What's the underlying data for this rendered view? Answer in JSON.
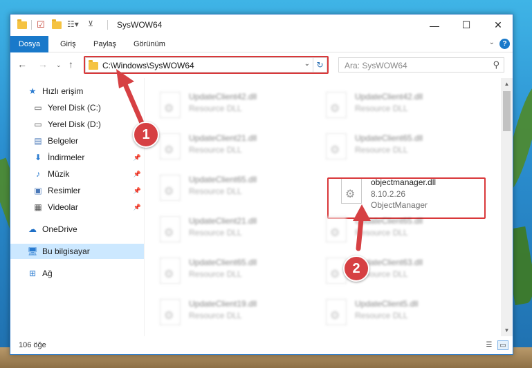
{
  "window": {
    "title": "SysWOW64",
    "minimize": "—",
    "maximize": "☐",
    "close": "✕"
  },
  "ribbon": {
    "tabs": [
      "Dosya",
      "Giriş",
      "Paylaş",
      "Görünüm"
    ],
    "help": "?"
  },
  "nav": {
    "address": "C:\\Windows\\SysWOW64",
    "search_placeholder": "Ara: SysWOW64"
  },
  "sidebar": {
    "items": [
      {
        "label": "Hızlı erişim",
        "icon": "star-icon"
      },
      {
        "label": "Yerel Disk (C:)",
        "icon": "drive-icon"
      },
      {
        "label": "Yerel Disk (D:)",
        "icon": "drive-icon"
      },
      {
        "label": "Belgeler",
        "icon": "documents-icon"
      },
      {
        "label": "İndirmeler",
        "icon": "download-icon"
      },
      {
        "label": "Müzik",
        "icon": "music-icon"
      },
      {
        "label": "Resimler",
        "icon": "pictures-icon"
      },
      {
        "label": "Videolar",
        "icon": "videos-icon"
      },
      {
        "label": "OneDrive",
        "icon": "cloud-icon"
      },
      {
        "label": "Bu bilgisayar",
        "icon": "computer-icon"
      },
      {
        "label": "Ağ",
        "icon": "network-icon"
      }
    ]
  },
  "files": [
    {
      "name": "UpdateClient42.dll",
      "type": "Resource DLL"
    },
    {
      "name": "UpdateClient42.dll",
      "type": "Resource DLL"
    },
    {
      "name": "UpdateClient21.dll",
      "type": "Resource DLL"
    },
    {
      "name": "UpdateClient65.dll",
      "type": "Resource DLL"
    },
    {
      "name": "UpdateClient65.dll",
      "type": "Resource DLL"
    },
    {
      "name": "objectmanager.dll",
      "version": "8.10.2.26",
      "type": "ObjectManager"
    },
    {
      "name": "UpdateClient21.dll",
      "type": "Resource DLL"
    },
    {
      "name": "UpdateClient65.dll",
      "type": "Resource DLL"
    },
    {
      "name": "UpdateClient65.dll",
      "type": "Resource DLL"
    },
    {
      "name": "UpdateClient63.dll",
      "type": "Resource DLL"
    },
    {
      "name": "UpdateClient19.dll",
      "type": "Resource DLL"
    },
    {
      "name": "UpdateClient5.dll",
      "type": "Resource DLL"
    }
  ],
  "status": {
    "count": "106 öğe"
  },
  "callouts": [
    "1",
    "2"
  ],
  "colors": {
    "accent": "#1979ca",
    "highlight": "#d9383a",
    "selected": "#cce8ff"
  }
}
